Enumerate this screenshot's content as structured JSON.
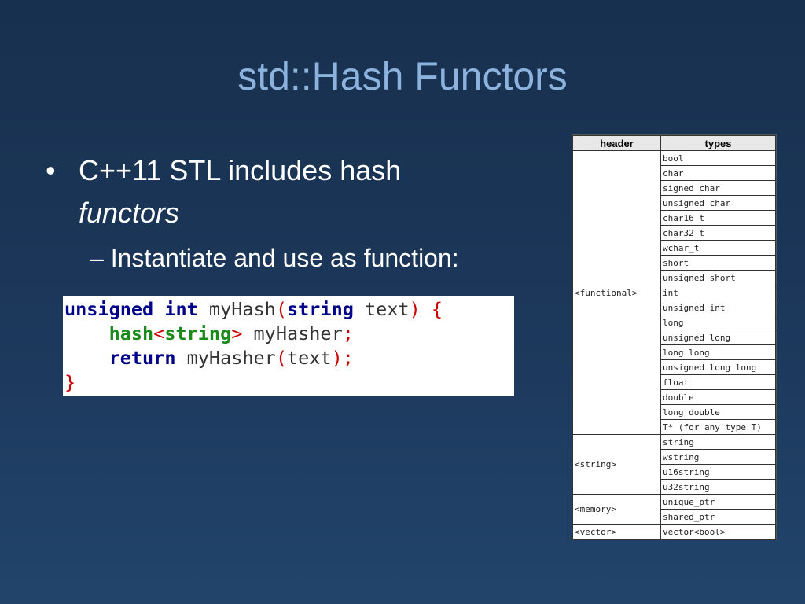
{
  "slide": {
    "title": "std::Hash Functors",
    "bullet1_text": "C++11 STL includes hash",
    "bullet1_italic": "functors",
    "bullet2_text": "– Instantiate and use as function:"
  },
  "code": {
    "l1_kw1": "unsigned int",
    "l1_name": " myHash",
    "l1_paren_open": "(",
    "l1_type": "string",
    "l1_param": " text",
    "l1_paren_close": ")",
    "l1_brace": " {",
    "l2_indent": "    ",
    "l2_hash": "hash",
    "l2_lt": "<",
    "l2_type": "string",
    "l2_gt": ">",
    "l2_var": " myHasher",
    "l2_semi": ";",
    "l3_indent": "    ",
    "l3_kw": "return",
    "l3_call": " myHasher",
    "l3_po": "(",
    "l3_arg": "text",
    "l3_pc": ")",
    "l3_semi": ";",
    "l4_brace": "}"
  },
  "table": {
    "col_header": "header",
    "col_types": "types",
    "groups": [
      {
        "header": "<functional>",
        "types": [
          "bool",
          "char",
          "signed char",
          "unsigned char",
          "char16_t",
          "char32_t",
          "wchar_t",
          "short",
          "unsigned short",
          "int",
          "unsigned int",
          "long",
          "unsigned long",
          "long long",
          "unsigned long long",
          "float",
          "double",
          "long double",
          "T* (for any type T)"
        ]
      },
      {
        "header": "<string>",
        "types": [
          "string",
          "wstring",
          "u16string",
          "u32string"
        ]
      },
      {
        "header": "<memory>",
        "types": [
          "unique_ptr",
          "shared_ptr"
        ]
      },
      {
        "header": "<vector>",
        "types": [
          "vector<bool>"
        ]
      }
    ]
  }
}
